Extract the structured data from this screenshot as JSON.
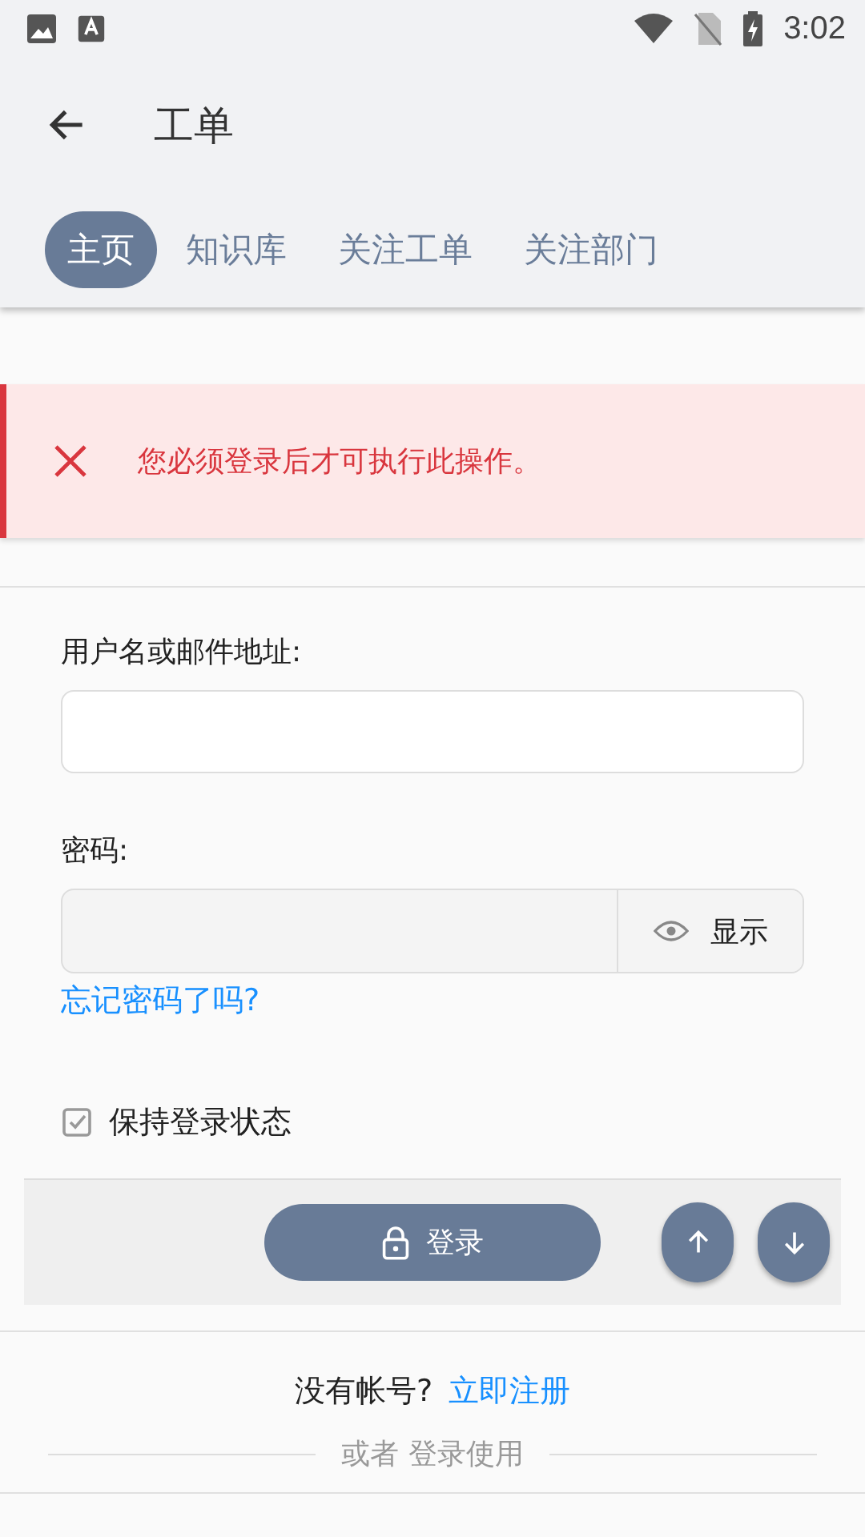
{
  "status_bar": {
    "time": "3:02"
  },
  "app_bar": {
    "title": "工单"
  },
  "tabs": [
    {
      "label": "主页",
      "selected": true
    },
    {
      "label": "知识库",
      "selected": false
    },
    {
      "label": "关注工单",
      "selected": false
    },
    {
      "label": "关注部门",
      "selected": false
    }
  ],
  "error_banner": {
    "message": "您必须登录后才可执行此操作。"
  },
  "form": {
    "username_label": "用户名或邮件地址:",
    "password_label": "密码:",
    "show_password": "显示",
    "forgot_link": "忘记密码了吗?",
    "remember": {
      "label": "保持登录状态",
      "checked": true
    },
    "login_button": "登录"
  },
  "footer": {
    "no_account": "没有帐号?",
    "register_link": "立即注册",
    "or_text": "或者 登录使用"
  }
}
